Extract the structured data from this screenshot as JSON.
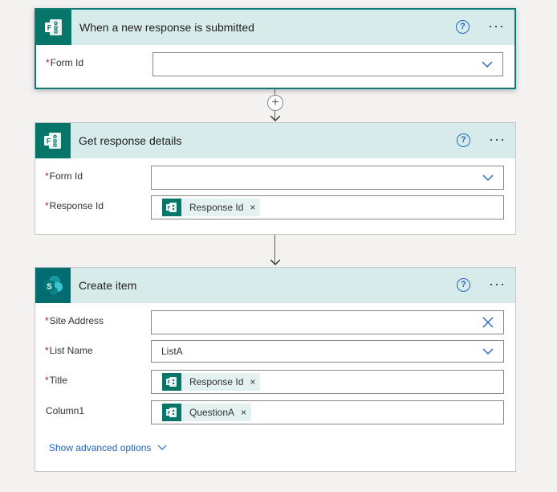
{
  "trigger": {
    "title": "When a new response is submitted",
    "help_glyph": "?",
    "more_glyph": "···",
    "fields": [
      {
        "label": "Form Id",
        "required_mark": "*",
        "value": ""
      }
    ]
  },
  "connector": {
    "plus_glyph": "+"
  },
  "get_details": {
    "title": "Get response details",
    "help_glyph": "?",
    "more_glyph": "···",
    "fields": [
      {
        "label": "Form Id",
        "required_mark": "*",
        "value": ""
      },
      {
        "label": "Response Id",
        "required_mark": "*",
        "token": "Response Id",
        "token_close": "×"
      }
    ]
  },
  "create_item": {
    "title": "Create item",
    "help_glyph": "?",
    "more_glyph": "···",
    "fields": [
      {
        "label": "Site Address",
        "required_mark": "*",
        "value": ""
      },
      {
        "label": "List Name",
        "required_mark": "*",
        "value": "ListA"
      },
      {
        "label": "Title",
        "required_mark": "*",
        "token": "Response Id",
        "token_close": "×"
      },
      {
        "label": "Column1",
        "required_mark": "",
        "token": "QuestionA",
        "token_close": "×"
      }
    ],
    "advanced_link": "Show advanced options"
  },
  "colors": {
    "header_bg": "#d8ebeb",
    "forms_teal": "#077568",
    "sharepoint_teal": "#036c70",
    "link_blue": "#2266c2",
    "required_red": "#a4262c"
  },
  "icons": {
    "forms": "forms-icon",
    "sharepoint": "sharepoint-icon",
    "help": "help-icon",
    "more": "more-options-icon",
    "dropdown": "chevron-down-icon",
    "clear": "clear-icon"
  }
}
